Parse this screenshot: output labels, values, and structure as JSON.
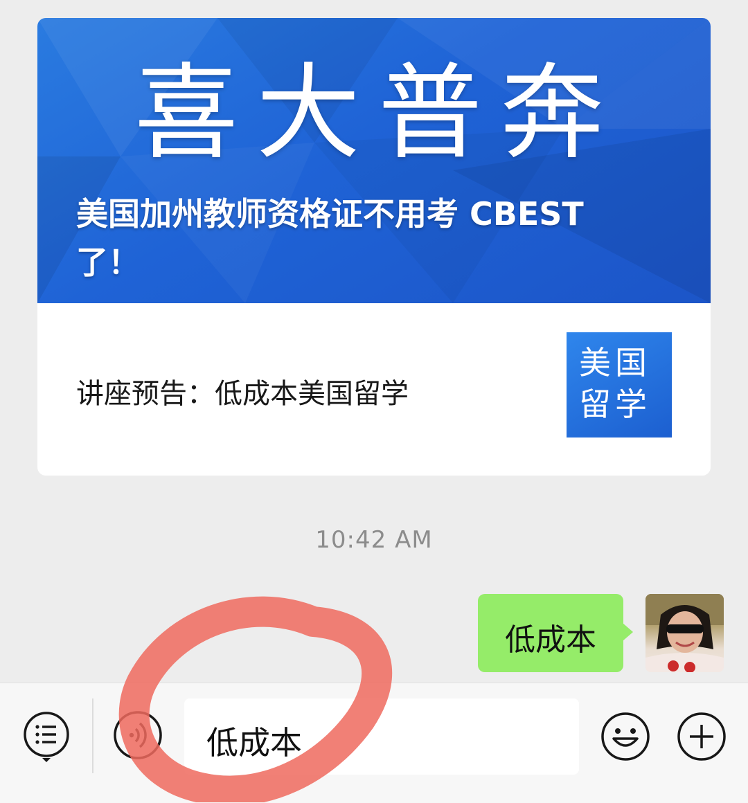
{
  "article_card": {
    "banner_art_text": "喜大普奔",
    "banner_title": "美国加州教师资格证不用考 CBEST 了！",
    "item_title": "讲座预告：低成本美国留学",
    "thumbnail_text": "美国留学"
  },
  "timestamp": "10:42 AM",
  "message": {
    "text": "低成本"
  },
  "input_bar": {
    "input_value": "低成本",
    "icons": [
      "menu-list-icon",
      "voice-icon",
      "emoji-icon",
      "plus-icon"
    ]
  },
  "colors": {
    "background": "#ededed",
    "banner_blue": "#1f63d6",
    "bubble_green": "#95ec69",
    "annotation_red": "#ee6a5e"
  }
}
